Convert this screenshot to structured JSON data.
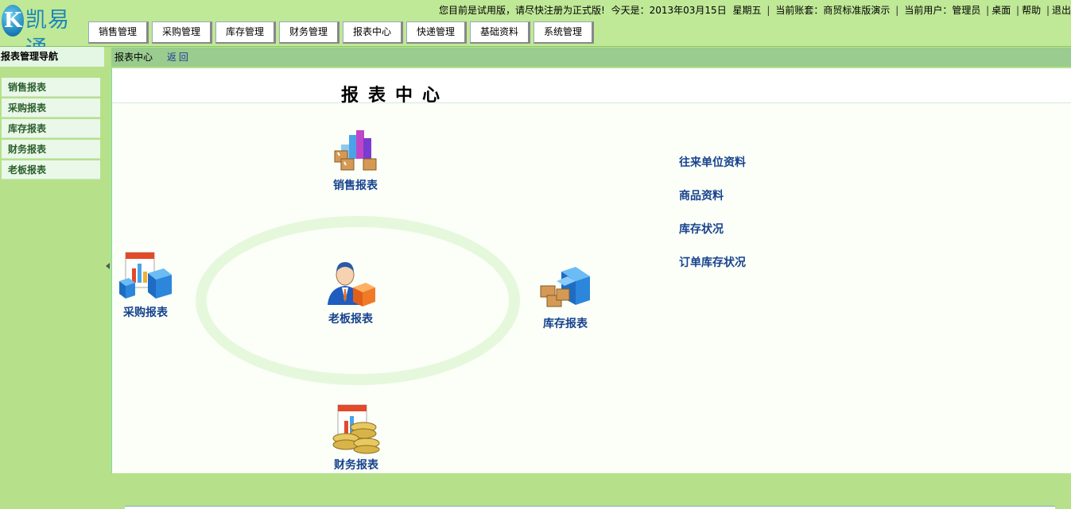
{
  "logo": {
    "mark": "K",
    "name": "凯易通"
  },
  "topinfo": {
    "notice": "您目前是试用版，请尽快注册为正式版!",
    "today_label": "今天是：2013年03月15日",
    "weekday": "星期五",
    "account": "当前账套：商贸标准版演示",
    "user": "当前用户：管理员",
    "desktop": "桌面",
    "help": "帮助",
    "logout": "退出"
  },
  "menu": [
    "销售管理",
    "采购管理",
    "库存管理",
    "财务管理",
    "报表中心",
    "快递管理",
    "基础资料",
    "系统管理"
  ],
  "sidebar": {
    "title": "报表管理导航",
    "items": [
      "销售报表",
      "采购报表",
      "库存报表",
      "财务报表",
      "老板报表"
    ]
  },
  "breadcrumb": {
    "current": "报表中心",
    "back": "返回"
  },
  "page_title": "报表中心",
  "nodes": {
    "sales": "销售报表",
    "purchase": "采购报表",
    "boss": "老板报表",
    "inventory": "库存报表",
    "finance": "财务报表"
  },
  "links": [
    "往来单位资料",
    "商品资料",
    "库存状况",
    "订单库存状况"
  ],
  "icons": {
    "sales": "bar-chart-boxes-icon",
    "purchase": "report-blue-cube-icon",
    "boss": "manager-person-icon",
    "inventory": "warehouse-house-icon",
    "finance": "report-coins-icon"
  }
}
